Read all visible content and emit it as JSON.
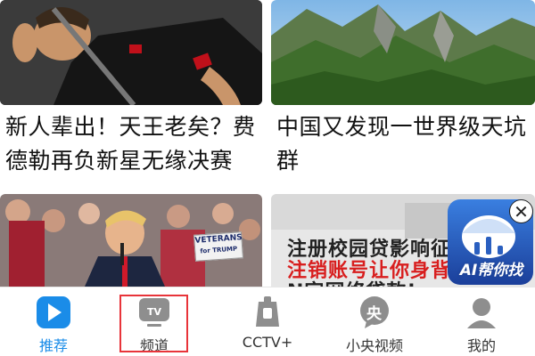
{
  "feed": {
    "cards": [
      {
        "title": "新人辈出！天王老矣？费德勒再负新星无缘决赛"
      },
      {
        "title": "中国又发现一世界级天坑群"
      },
      {
        "image_caption": [
          "VETERANS",
          "for TRUMP"
        ]
      },
      {
        "overlay_lines": [
          "注册校园贷影响征",
          "注销账号让你身背",
          "N字网络贷款!"
        ]
      }
    ]
  },
  "ad": {
    "label": "AI帮你找",
    "close_symbol": "✕"
  },
  "tabbar": {
    "tabs": [
      {
        "label": "推荐",
        "icon": "play-icon",
        "active": true
      },
      {
        "label": "频道",
        "icon": "tv-icon",
        "active": false,
        "highlighted": true
      },
      {
        "label": "CCTV+",
        "icon": "cctv-plus-icon",
        "active": false
      },
      {
        "label": "小央视频",
        "icon": "yang-icon",
        "active": false,
        "icon_text": "央"
      },
      {
        "label": "我的",
        "icon": "person-icon",
        "active": false
      }
    ]
  },
  "colors": {
    "accent": "#1a8ce8",
    "highlight": "#e8343a",
    "text": "#111111"
  }
}
